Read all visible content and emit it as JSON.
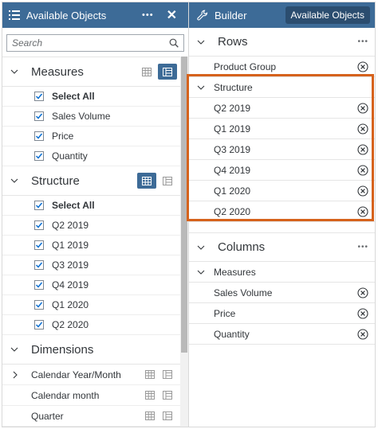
{
  "left_panel": {
    "title": "Available Objects",
    "more_glyph": "•••",
    "close_glyph": "✕",
    "search_placeholder": "Search",
    "measures": {
      "label": "Measures",
      "items": [
        {
          "label": "Select All",
          "checked": true,
          "bold": true
        },
        {
          "label": "Sales Volume",
          "checked": true
        },
        {
          "label": "Price",
          "checked": true
        },
        {
          "label": "Quantity",
          "checked": true
        }
      ]
    },
    "structure": {
      "label": "Structure",
      "items": [
        {
          "label": "Select All",
          "checked": true,
          "bold": true
        },
        {
          "label": "Q2 2019",
          "checked": true
        },
        {
          "label": "Q1 2019",
          "checked": true
        },
        {
          "label": "Q3 2019",
          "checked": true
        },
        {
          "label": "Q4 2019",
          "checked": true
        },
        {
          "label": "Q1 2020",
          "checked": true
        },
        {
          "label": "Q2 2020",
          "checked": true
        }
      ]
    },
    "dimensions": {
      "label": "Dimensions",
      "items": [
        {
          "label": "Calendar Year/Month",
          "expandable": true
        },
        {
          "label": "Calendar month"
        },
        {
          "label": "Quarter"
        }
      ]
    }
  },
  "builder": {
    "title": "Builder",
    "available_objects_button": "Available Objects",
    "more_glyph": "•••",
    "rows": {
      "label": "Rows",
      "product_group": "Product Group",
      "structure_label": "Structure",
      "structure_items": [
        "Q2 2019",
        "Q1 2019",
        "Q3 2019",
        "Q4 2019",
        "Q1 2020",
        "Q2 2020"
      ]
    },
    "columns": {
      "label": "Columns",
      "measures_label": "Measures",
      "measure_items": [
        "Sales Volume",
        "Price",
        "Quantity"
      ]
    }
  },
  "colors": {
    "header_blue": "#3d6b97",
    "active_view_btn": "#3d6b97",
    "highlight_orange": "#d6621c",
    "checkbox_blue": "#0a6ed1"
  },
  "icons": [
    "list-icon",
    "more-icon",
    "close-icon",
    "search-icon",
    "chevron-down-icon",
    "chevron-right-icon",
    "table-view-icon",
    "column-view-icon",
    "checkbox-icon",
    "wrench-icon",
    "remove-circle-icon"
  ]
}
